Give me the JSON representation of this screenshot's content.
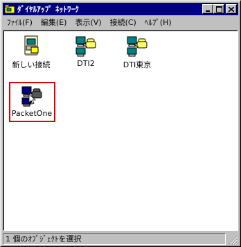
{
  "window": {
    "title": "ﾀﾞｲﾔﾙｱｯﾌﾟ ﾈｯﾄﾜｰｸ",
    "icon": "folder-icon",
    "buttons": [
      "minimize-icon",
      "maximize-icon",
      "close-icon"
    ]
  },
  "menu": [
    {
      "label": "ﾌｧｲﾙ(F)"
    },
    {
      "label": "編集(E)"
    },
    {
      "label": "表示(V)"
    },
    {
      "label": "接続(C)"
    },
    {
      "label": "ﾍﾙﾌﾟ(H)"
    }
  ],
  "items": [
    {
      "label": "新しい接続",
      "icon": "new-connection-icon"
    },
    {
      "label": "DTI2",
      "icon": "dialup-connection-icon"
    },
    {
      "label": "DTI東京",
      "icon": "dialup-connection-icon"
    },
    {
      "label": "PacketOne",
      "icon": "dialup-connection-icon",
      "selected": true
    }
  ],
  "status": {
    "text": "1 個のｵﾌﾞｼﾞｪｸﾄを選択"
  },
  "colors": {
    "title_bar": "#000080",
    "window_face": "#c0c0c0",
    "highlight_box": "#e00000"
  }
}
